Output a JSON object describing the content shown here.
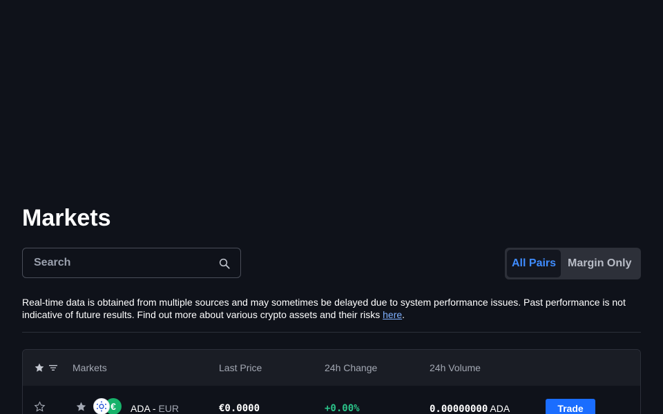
{
  "page": {
    "title": "Markets"
  },
  "search": {
    "placeholder": "Search",
    "value": ""
  },
  "filter_tabs": [
    {
      "label": "All Pairs",
      "active": true
    },
    {
      "label": "Margin Only",
      "active": false
    }
  ],
  "disclaimer": {
    "text": "Real-time data is obtained from multiple sources and may sometimes be delayed due to system performance issues. Past performance is not indicative of future results. Find out more about various crypto assets and their risks ",
    "link_text": "here",
    "suffix": "."
  },
  "table": {
    "headers": {
      "markets": "Markets",
      "last_price": "Last Price",
      "change_24h": "24h Change",
      "volume_24h": "24h Volume"
    },
    "rows": [
      {
        "base": "ADA",
        "separator": "-",
        "quote": "EUR",
        "fiat_glyph": "€",
        "last_price": "€0.0000",
        "change_24h": "+0.00%",
        "volume_amount": "0.00000000",
        "volume_unit": "ADA",
        "trade_label": "Trade"
      }
    ]
  },
  "colors": {
    "background": "#0f121a",
    "accent": "#3f8cff",
    "trade_button": "#1a6dff",
    "positive": "#2bc48a"
  },
  "icons": {
    "search": "search-icon",
    "header_star": "star-filled-icon",
    "header_filter": "filter-icon",
    "row_favorite": "star-outline-icon",
    "row_star": "star-filled-icon",
    "base_coin": "cardano-coin-icon"
  }
}
